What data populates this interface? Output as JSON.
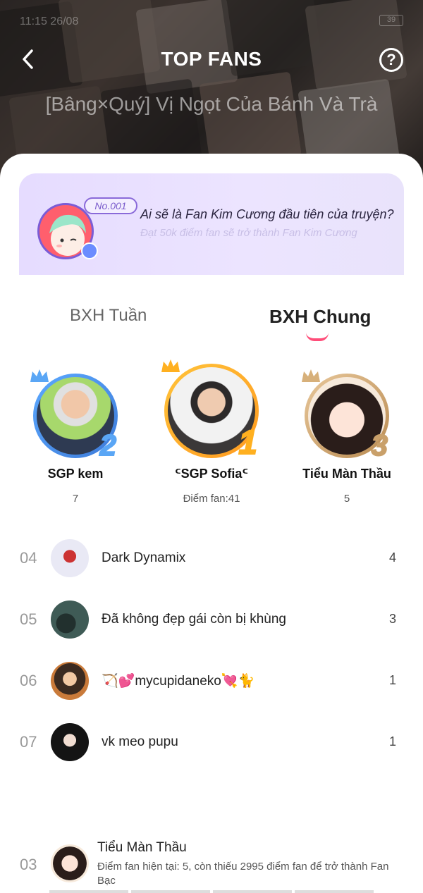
{
  "status_bar": {
    "time": "11:15 26/08",
    "battery": "39"
  },
  "header": {
    "title": "TOP FANS",
    "help_label": "?",
    "story_title": "[Bâng×Quý] Vị Ngọt Của Bánh Và Trà"
  },
  "promo": {
    "badge": "No.001",
    "title": "Ai sẽ là Fan Kim Cương đầu tiên của truyện?",
    "subtitle": "Đạt 50k điểm fan sẽ trở thành Fan Kim Cương"
  },
  "tabs": [
    {
      "label": "BXH Tuần",
      "active": false
    },
    {
      "label": "BXH Chung",
      "active": true
    }
  ],
  "podium": {
    "first": {
      "rank": "1",
      "name": "ᑦSGP Sofiaᑦ",
      "score": "Điểm fan:41"
    },
    "second": {
      "rank": "2",
      "name": "SGP kem",
      "score": "7"
    },
    "third": {
      "rank": "3",
      "name": "Tiểu Màn Thầu",
      "score": "5"
    }
  },
  "list": [
    {
      "rank": "04",
      "name": "Dark Dynamix",
      "score": "4"
    },
    {
      "rank": "05",
      "name": "Đã không đẹp gái còn bị khùng",
      "score": "3"
    },
    {
      "rank": "06",
      "name": "🏹💕mycupidaneko💘🐈",
      "score": "1"
    },
    {
      "rank": "07",
      "name": "vk meo pupu",
      "score": "1"
    }
  ],
  "me": {
    "rank": "03",
    "name": "Tiểu Màn Thầu",
    "description": "Điểm fan hiện tại: 5, còn thiếu 2995 điểm fan để trở thành Fan Bạc",
    "progress": 0
  },
  "colors": {
    "accent": "#ff4d79",
    "gold": "#ffb020",
    "silver": "#5aa6f5",
    "bronze": "#c9a06a",
    "promo_bg": "#e6dcff"
  }
}
